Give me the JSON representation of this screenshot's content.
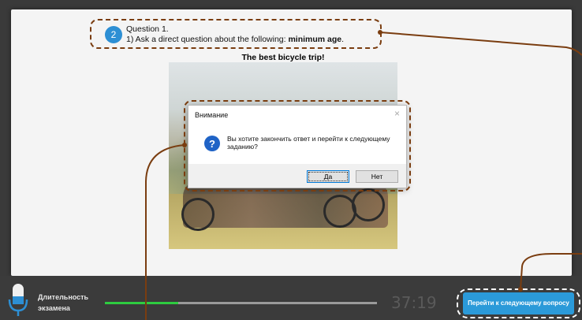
{
  "question": {
    "number": "2",
    "title": "Question 1.",
    "prompt_prefix": "1) Ask a direct question about the following: ",
    "prompt_bold": "minimum age",
    "prompt_suffix": "."
  },
  "picture": {
    "title": "The best bicycle trip!"
  },
  "dialog": {
    "title": "Внимание",
    "close": "×",
    "icon": "?",
    "message": "Вы хотите закончить ответ и перейти к следующему заданию?",
    "yes_label": "Да",
    "no_label": "Нет"
  },
  "footer": {
    "duration_label_line1": "Длительность",
    "duration_label_line2": "экзамена",
    "timer": "37:19",
    "progress_percent": 27,
    "next_button": "Перейти к следующему вопросу"
  },
  "colors": {
    "accent": "#2b9ad9",
    "annotation": "#7a3d10",
    "progress": "#2ecc40"
  }
}
